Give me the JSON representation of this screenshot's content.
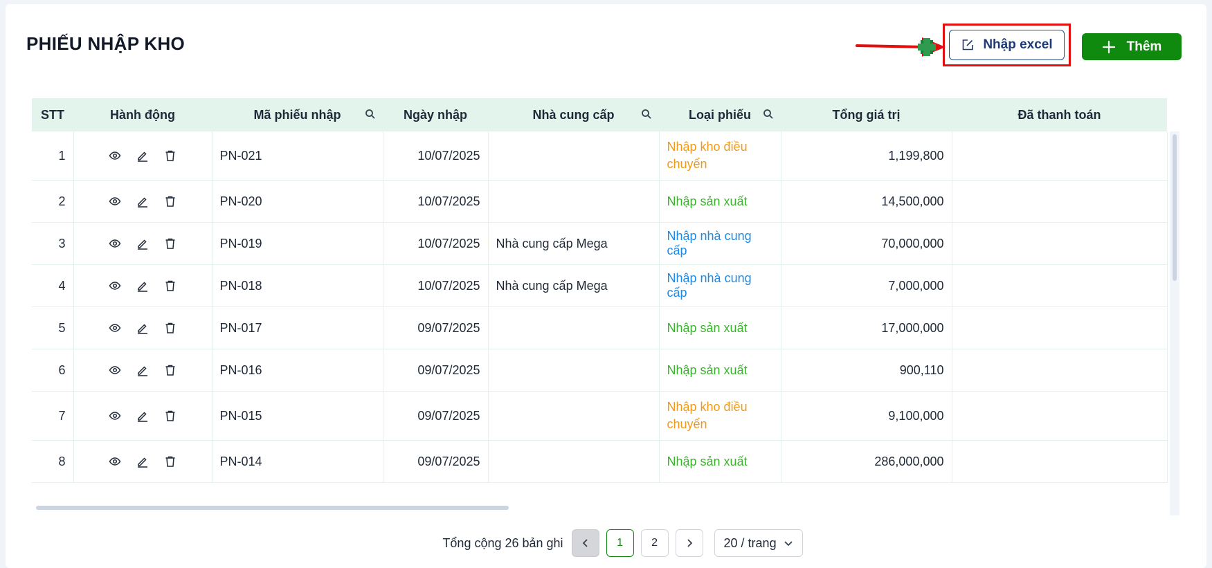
{
  "page": {
    "title": "PHIẾU NHẬP KHO"
  },
  "toolbar": {
    "import_label": "Nhập excel",
    "add_label": "Thêm"
  },
  "colors": {
    "primary_green": "#0f8a0f",
    "header_bg": "#e2f4ec",
    "import_blue": "#1e3a78",
    "highlight_red": "#e01010",
    "type_transfer": "#f09a1a",
    "type_production": "#3db22f",
    "type_supplier": "#1d8be6"
  },
  "icons": {
    "view": "eye-icon",
    "edit": "pencil-icon",
    "delete": "trash-icon",
    "search": "search-icon",
    "import": "edit-square-icon",
    "add": "plus-icon"
  },
  "table": {
    "columns": [
      "STT",
      "Hành động",
      "Mã phiếu nhập",
      "Ngày nhập",
      "Nhà cung cấp",
      "Loại phiếu",
      "Tổng giá trị",
      "Đã thanh toán"
    ],
    "rows": [
      {
        "stt": "1",
        "code": "PN-021",
        "date": "10/07/2025",
        "supplier": "",
        "type": "Nhập kho điều chuyển",
        "type_kind": "transfer",
        "total": "1,199,800",
        "paid": ""
      },
      {
        "stt": "2",
        "code": "PN-020",
        "date": "10/07/2025",
        "supplier": "",
        "type": "Nhập sản xuất",
        "type_kind": "production",
        "total": "14,500,000",
        "paid": ""
      },
      {
        "stt": "3",
        "code": "PN-019",
        "date": "10/07/2025",
        "supplier": "Nhà cung cấp Mega",
        "type": "Nhập nhà cung cấp",
        "type_kind": "supplier",
        "total": "70,000,000",
        "paid": ""
      },
      {
        "stt": "4",
        "code": "PN-018",
        "date": "10/07/2025",
        "supplier": "Nhà cung cấp Mega",
        "type": "Nhập nhà cung cấp",
        "type_kind": "supplier",
        "total": "7,000,000",
        "paid": ""
      },
      {
        "stt": "5",
        "code": "PN-017",
        "date": "09/07/2025",
        "supplier": "",
        "type": "Nhập sản xuất",
        "type_kind": "production",
        "total": "17,000,000",
        "paid": ""
      },
      {
        "stt": "6",
        "code": "PN-016",
        "date": "09/07/2025",
        "supplier": "",
        "type": "Nhập sản xuất",
        "type_kind": "production",
        "total": "900,110",
        "paid": ""
      },
      {
        "stt": "7",
        "code": "PN-015",
        "date": "09/07/2025",
        "supplier": "",
        "type": "Nhập kho điều chuyển",
        "type_kind": "transfer",
        "total": "9,100,000",
        "paid": ""
      },
      {
        "stt": "8",
        "code": "PN-014",
        "date": "09/07/2025",
        "supplier": "",
        "type": "Nhập sản xuất",
        "type_kind": "production",
        "total": "286,000,000",
        "paid": ""
      }
    ]
  },
  "pagination": {
    "total_text": "Tổng cộng 26 bản ghi",
    "pages": [
      "1",
      "2"
    ],
    "current_page": "1",
    "page_size_label": "20 / trang"
  }
}
